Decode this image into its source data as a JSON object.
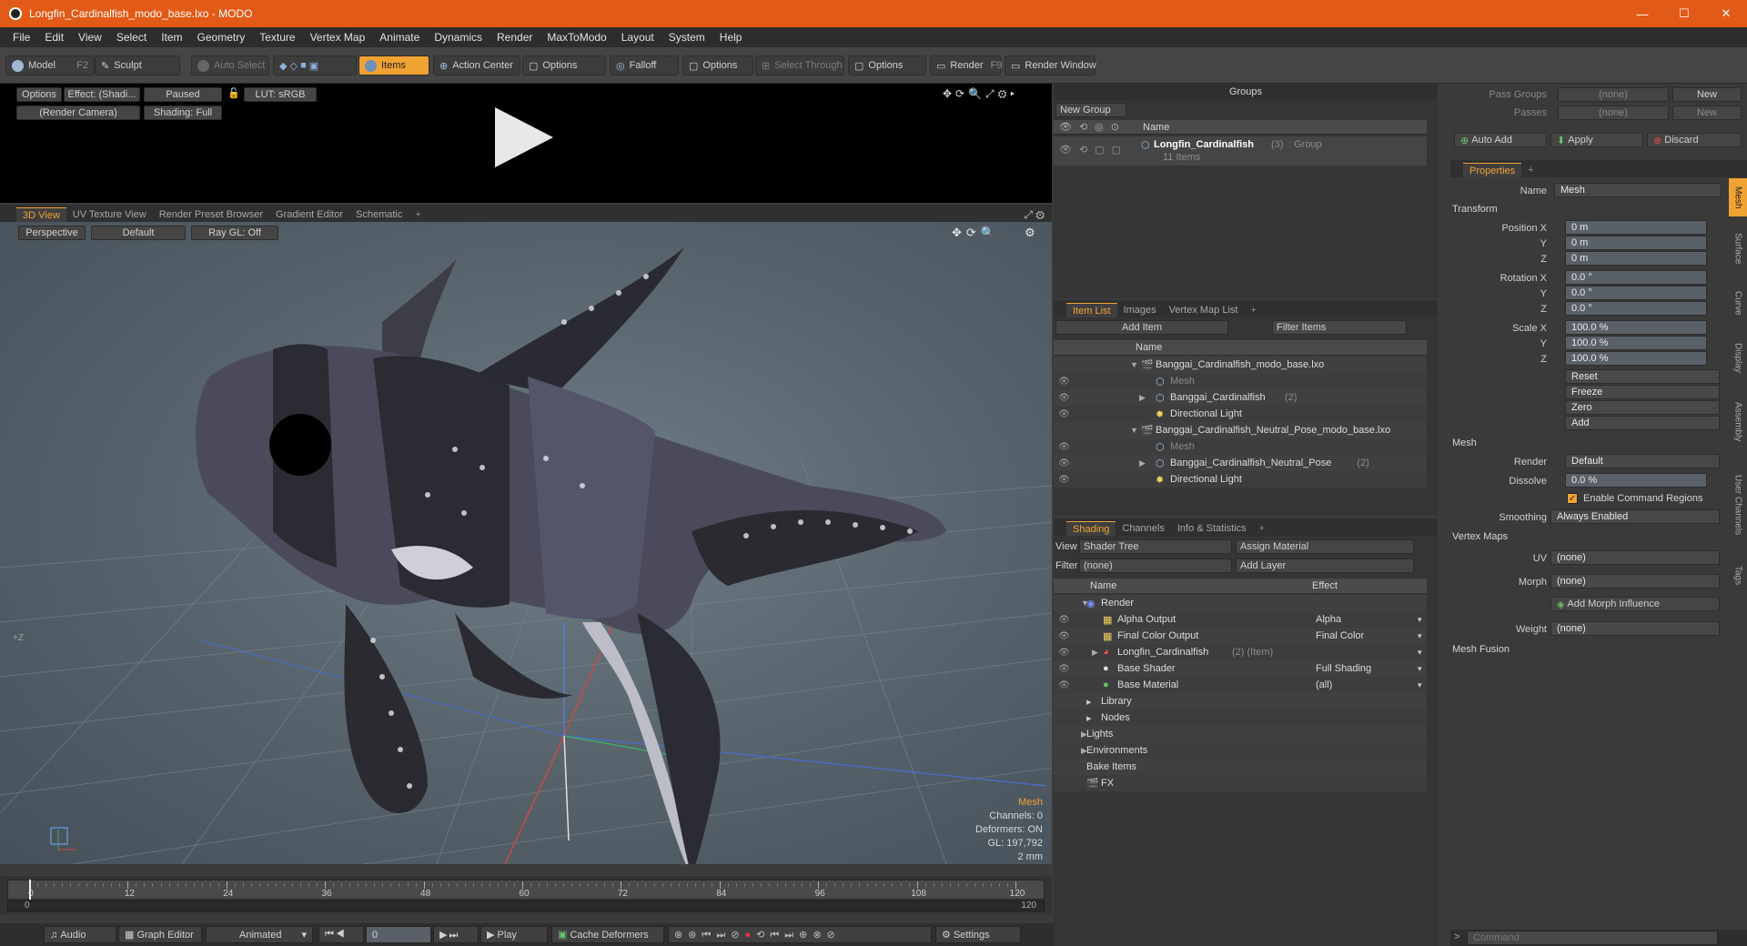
{
  "window": {
    "title": "Longfin_Cardinalfish_modo_base.lxo - MODO",
    "minimize": "—",
    "maximize": "☐",
    "close": "✕"
  },
  "menu": [
    "File",
    "Edit",
    "View",
    "Select",
    "Item",
    "Geometry",
    "Texture",
    "Vertex Map",
    "Animate",
    "Dynamics",
    "Render",
    "MaxToModo",
    "Layout",
    "System",
    "Help"
  ],
  "toolbar": {
    "model": "Model",
    "model_key": "F2",
    "sculpt": "Sculpt",
    "auto_select": "Auto Select",
    "items": "Items",
    "action_center": "Action Center",
    "options1": "Options",
    "falloff": "Falloff",
    "options2": "Options",
    "select_through": "Select Through",
    "options3": "Options",
    "render": "Render",
    "render_key": "F9",
    "render_window": "Render Window"
  },
  "preview": {
    "options": "Options",
    "effect": "Effect: (Shadi...",
    "paused": "Paused",
    "lut": "LUT: sRGB",
    "camera": "(Render Camera)",
    "shading": "Shading: Full"
  },
  "viewport_tabs": [
    "3D View",
    "UV Texture View",
    "Render Preset Browser",
    "Gradient Editor",
    "Schematic",
    "+"
  ],
  "viewport": {
    "projection": "Perspective",
    "style": "Default",
    "raygl": "Ray GL: Off",
    "axis_hint": "+Z",
    "info": {
      "mesh": "Mesh",
      "channels": "Channels: 0",
      "deformers": "Deformers: ON",
      "gl": "GL: 197,792",
      "unit": "2 mm"
    }
  },
  "timeline": {
    "ticks": [
      "0",
      "12",
      "24",
      "36",
      "48",
      "60",
      "72",
      "84",
      "96",
      "108",
      "120"
    ],
    "start": "0",
    "end": "120"
  },
  "bottombar": {
    "audio": "Audio",
    "graph_editor": "Graph Editor",
    "animated": "Animated",
    "frame": "0",
    "play": "Play",
    "cache": "Cache Deformers",
    "settings": "Settings"
  },
  "groups": {
    "title": "Groups",
    "new_group": "New Group",
    "col_name": "Name",
    "group_name": "Longfin_Cardinalfish",
    "group_count": "(3)",
    "group_type": ": Group",
    "group_items": "11 Items"
  },
  "itemlist": {
    "tabs": [
      "Item List",
      "Images",
      "Vertex Map List",
      "+"
    ],
    "add_item": "Add Item",
    "filter": "Filter Items",
    "col_name": "Name",
    "rows": [
      {
        "label": "Banggai_Cardinalfish_modo_base.lxo",
        "indent": 0,
        "dim": false,
        "arrow": "▼"
      },
      {
        "label": "Mesh",
        "indent": 1,
        "dim": true,
        "arrow": ""
      },
      {
        "label": "Banggai_Cardinalfish",
        "extra": "(2)",
        "indent": 1,
        "dim": false,
        "arrow": "▶"
      },
      {
        "label": "Directional Light",
        "indent": 1,
        "dim": false,
        "arrow": ""
      },
      {
        "label": "Banggai_Cardinalfish_Neutral_Pose_modo_base.lxo",
        "indent": 0,
        "dim": false,
        "arrow": "▼"
      },
      {
        "label": "Mesh",
        "indent": 1,
        "dim": true,
        "arrow": ""
      },
      {
        "label": "Banggai_Cardinalfish_Neutral_Pose",
        "extra": "(2)",
        "indent": 1,
        "dim": false,
        "arrow": "▶"
      },
      {
        "label": "Directional Light",
        "indent": 1,
        "dim": false,
        "arrow": ""
      }
    ]
  },
  "shading": {
    "tabs": [
      "Shading",
      "Channels",
      "Info & Statistics",
      "+"
    ],
    "view_label": "View",
    "view_value": "Shader Tree",
    "assign": "Assign Material",
    "filter_label": "Filter",
    "filter_value": "(none)",
    "add_layer": "Add Layer",
    "col_name": "Name",
    "col_effect": "Effect",
    "rows": [
      {
        "label": "Render",
        "effect": "",
        "indent": 0
      },
      {
        "label": "Alpha Output",
        "effect": "Alpha",
        "indent": 1
      },
      {
        "label": "Final Color Output",
        "effect": "Final Color",
        "indent": 1
      },
      {
        "label": "Longfin_Cardinalfish",
        "extra": "(2) (Item)",
        "effect": "",
        "indent": 1
      },
      {
        "label": "Base Shader",
        "effect": "Full Shading",
        "indent": 1
      },
      {
        "label": "Base Material",
        "effect": "(all)",
        "indent": 1
      },
      {
        "label": "Library",
        "effect": "",
        "indent": 0
      },
      {
        "label": "Nodes",
        "effect": "",
        "indent": 0
      },
      {
        "label": "Lights",
        "effect": "",
        "indent": 0
      },
      {
        "label": "Environments",
        "effect": "",
        "indent": 0
      },
      {
        "label": "Bake Items",
        "effect": "",
        "indent": 0
      },
      {
        "label": "FX",
        "effect": "",
        "indent": 0
      }
    ]
  },
  "passes": {
    "pass_groups": "Pass Groups",
    "passes": "Passes",
    "none1": "(none)",
    "none2": "(none)",
    "new1": "New",
    "new2": "New",
    "auto_add": "Auto Add",
    "apply": "Apply",
    "discard": "Discard"
  },
  "properties": {
    "tab": "Properties",
    "plus": "+",
    "name_label": "Name",
    "name_value": "Mesh",
    "transform": "Transform",
    "position_label": "Position X",
    "rotation_label": "Rotation X",
    "scale_label": "Scale X",
    "y": "Y",
    "z": "Z",
    "pos": [
      "0 m",
      "0 m",
      "0 m"
    ],
    "rot": [
      "0.0 °",
      "0.0 °",
      "0.0 °"
    ],
    "scale": [
      "100.0 %",
      "100.0 %",
      "100.0 %"
    ],
    "reset": "Reset",
    "freeze": "Freeze",
    "zero": "Zero",
    "add": "Add",
    "mesh": "Mesh",
    "render_label": "Render",
    "render_value": "Default",
    "dissolve_label": "Dissolve",
    "dissolve_value": "0.0 %",
    "command_regions": "Enable Command Regions",
    "smoothing_label": "Smoothing",
    "smoothing_value": "Always Enabled",
    "vertex_maps": "Vertex Maps",
    "uv_label": "UV",
    "uv_value": "(none)",
    "morph_label": "Morph",
    "morph_value": "(none)",
    "add_morph": "Add Morph Influence",
    "weight_label": "Weight",
    "weight_value": "(none)",
    "mesh_fusion": "Mesh Fusion"
  },
  "side_tabs": [
    "Mesh",
    "Surface",
    "Curve",
    "Display",
    "Assembly",
    "User Channels",
    "Tags"
  ],
  "command": {
    "placeholder": "Command"
  },
  "colors": {
    "accent": "#f0a232",
    "title": "#e15a17"
  }
}
